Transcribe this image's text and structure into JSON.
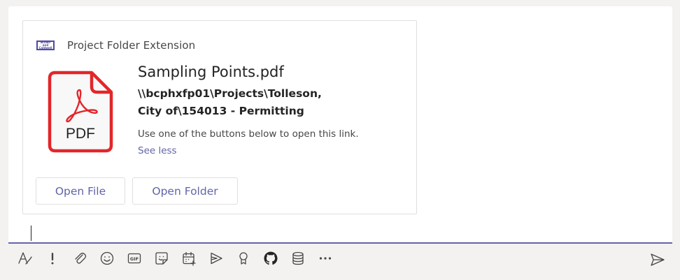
{
  "card": {
    "app_name": "Project Folder Extension",
    "brand_logo_text": "Brown and Caldwell",
    "file_title": "Sampling Points.pdf",
    "file_path": "\\\\bcphxfp01\\Projects\\Tolleson, City of\\154013 - Permitting",
    "file_icon_label": "PDF",
    "hint": "Use one of the buttons below to open this link.",
    "see_less": "See less",
    "buttons": {
      "open_file": "Open File",
      "open_folder": "Open Folder"
    }
  },
  "toolbar": {
    "gif_label": "GIF",
    "icons": [
      "format-icon",
      "important-icon",
      "attach-icon",
      "emoji-icon",
      "gif-icon",
      "sticker-icon",
      "schedule-meeting-icon",
      "stream-icon",
      "praise-icon",
      "github-icon",
      "database-icon",
      "more-options-icon"
    ]
  },
  "colors": {
    "accent": "#6264a7",
    "pdf_red": "#e3262a",
    "text": "#252423",
    "border": "#e1dfdd",
    "background": "#f3f2f1",
    "icon": "#484644"
  }
}
